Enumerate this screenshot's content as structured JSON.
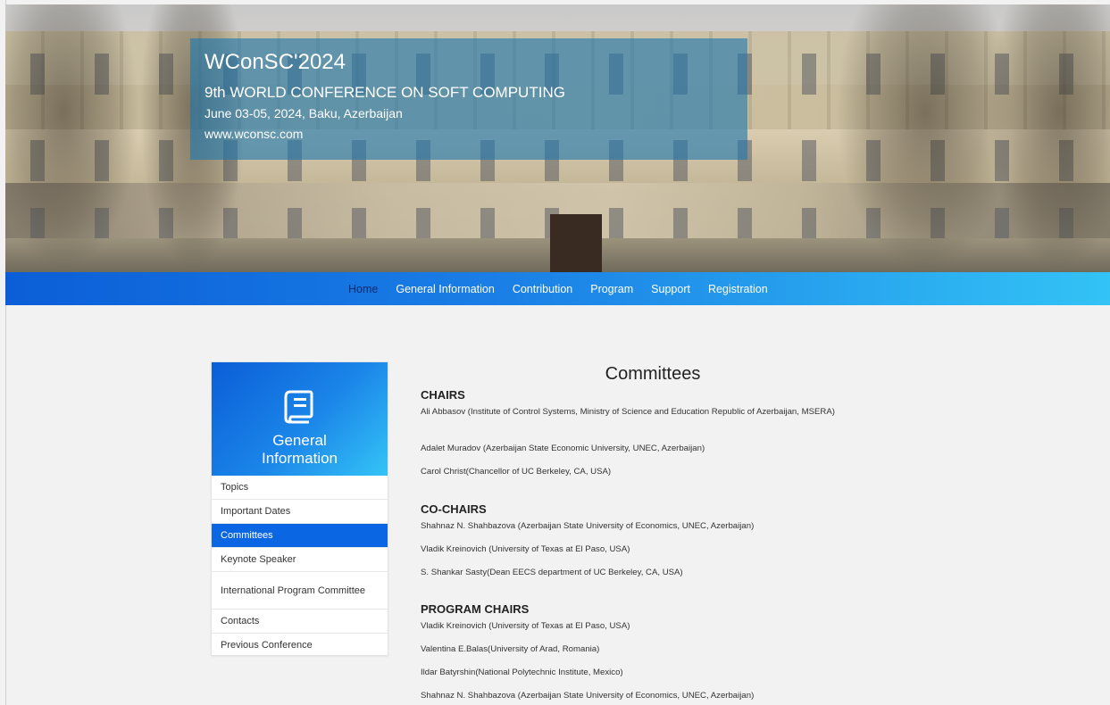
{
  "banner": {
    "title": "WConSC'2024",
    "subtitle": "9th WORLD CONFERENCE ON SOFT COMPUTING",
    "date_location": "June 03-05, 2024, Baku, Azerbaijan",
    "website": "www.wconsc.com"
  },
  "nav": {
    "items": [
      {
        "label": "Home",
        "active": true
      },
      {
        "label": "General Information",
        "active": false
      },
      {
        "label": "Contribution",
        "active": false
      },
      {
        "label": "Program",
        "active": false
      },
      {
        "label": "Support",
        "active": false
      },
      {
        "label": "Registration",
        "active": false
      }
    ]
  },
  "sidebar": {
    "icon": "book-icon",
    "title_line1": "General",
    "title_line2": "Information",
    "items": [
      {
        "label": "Topics"
      },
      {
        "label": "Important Dates"
      },
      {
        "label": "Committees",
        "active": true
      },
      {
        "label": "Keynote Speaker"
      },
      {
        "label": "International Program Committee"
      },
      {
        "label": "Contacts"
      },
      {
        "label": "Previous Conference"
      }
    ]
  },
  "content": {
    "title": "Committees",
    "sections": [
      {
        "heading": "CHAIRS",
        "members": [
          "Ali Abbasov (Institute of Control Systems, Ministry of Science and Education Republic of Azerbaijan, MSERA)",
          "Adalet Muradov (Azerbaijan State Economic University, UNEC, Azerbaijan)",
          "Carol Christ(Chancellor of UC Berkeley, CA, USA)"
        ]
      },
      {
        "heading": "CO-CHAIRS",
        "members": [
          "Shahnaz N. Shahbazova (Azerbaijan State University of Economics, UNEC, Azerbaijan)",
          "Vladik Kreinovich (University of Texas at El Paso, USA)",
          "S. Shankar Sasty(Dean EECS department of UC Berkeley, CA, USA)"
        ]
      },
      {
        "heading": "PROGRAM CHAIRS",
        "members": [
          "Vladik Kreinovich (University of Texas at El Paso, USA)",
          "Valentina E.Balas(University of Arad, Romania)",
          "Ildar Batyrshin(National Polytechnic Institute, Mexico)",
          "Shahnaz N. Shahbazova (Azerbaijan State University of Economics, UNEC, Azerbaijan)"
        ]
      }
    ]
  }
}
